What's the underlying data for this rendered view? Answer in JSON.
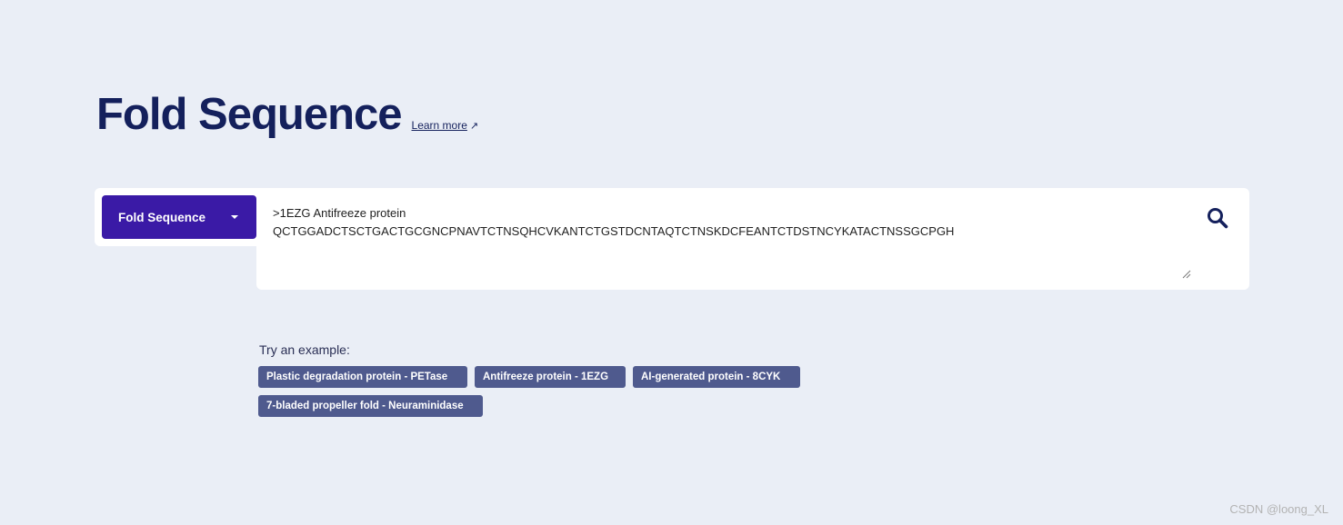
{
  "header": {
    "title": "Fold Sequence",
    "learn_more": "Learn more",
    "learn_more_icon": "external-arrow-icon"
  },
  "mode_dropdown": {
    "selected": "Fold Sequence",
    "icon": "caret-down-icon"
  },
  "sequence_input": {
    "value_line1": ">1EZG Antifreeze protein",
    "value_line2": "QCTGGADCTSCTGACTGCGNCPNAVTCTNSQHCVKANTCTGSTDCNTAQTCTNSKDCFEANTCTDSTNCYKATACTNSSGCPGH"
  },
  "search_button": {
    "icon": "search-icon"
  },
  "examples": {
    "label": "Try an example:",
    "items": [
      "Plastic degradation protein - PETase",
      "Antifreeze protein - 1EZG",
      "AI-generated protein - 8CYK",
      "7-bladed propeller fold - Neuraminidase"
    ]
  },
  "watermark": "CSDN @loong_XL",
  "colors": {
    "background": "#eaeef6",
    "title": "#14205c",
    "primary_button": "#3a1aa6",
    "chip": "#4f5a8e"
  }
}
